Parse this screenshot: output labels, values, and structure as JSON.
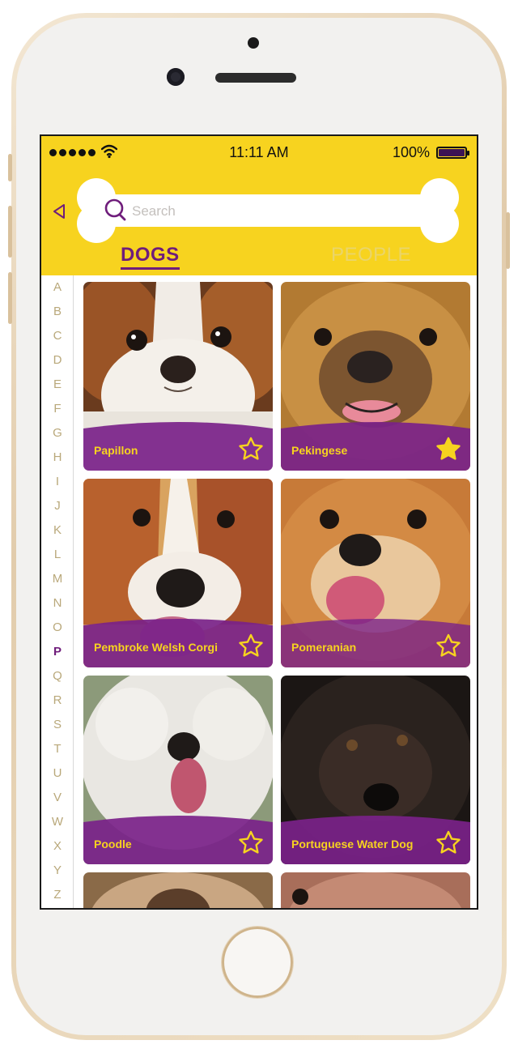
{
  "status_bar": {
    "time": "11:11 AM",
    "battery": "100%"
  },
  "search": {
    "placeholder": "Search"
  },
  "tabs": {
    "dogs": "DOGS",
    "people": "PEOPLE"
  },
  "alphabet": [
    "A",
    "B",
    "C",
    "D",
    "E",
    "F",
    "G",
    "H",
    "I",
    "J",
    "K",
    "L",
    "M",
    "N",
    "O",
    "P",
    "Q",
    "R",
    "S",
    "T",
    "U",
    "V",
    "W",
    "X",
    "Y",
    "Z"
  ],
  "active_letter": "P",
  "cards": [
    {
      "name": "Papillon",
      "favorite": false
    },
    {
      "name": "Pekingese",
      "favorite": true
    },
    {
      "name": "Pembroke Welsh Corgi",
      "favorite": false
    },
    {
      "name": "Pomeranian",
      "favorite": false
    },
    {
      "name": "Poodle",
      "favorite": false
    },
    {
      "name": "Portuguese Water Dog",
      "favorite": false
    }
  ],
  "colors": {
    "accent_yellow": "#f7d31f",
    "accent_purple": "#6f1d7b"
  }
}
